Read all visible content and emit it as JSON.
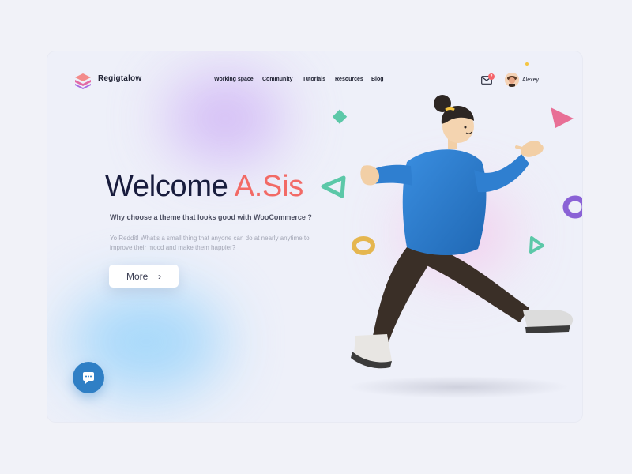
{
  "brand": {
    "name": "Regigtalow"
  },
  "nav": {
    "items": [
      {
        "label": "Working space"
      },
      {
        "label": "Community"
      },
      {
        "label": "Tutorials"
      },
      {
        "label": "Resources"
      },
      {
        "label": "Blog"
      }
    ]
  },
  "header": {
    "mail_badge": "2",
    "user_name": "Alexey"
  },
  "hero": {
    "welcome": "Welcome",
    "name": "A.Sis",
    "subtitle": "Why choose a theme that looks good with WooCommerce ?",
    "description": "Yo Reddit! What’s a small thing that anyone can do at nearly anytime to improve their mood and make them happier?",
    "more_label": "More"
  },
  "colors": {
    "accent": "#f26a66",
    "heading": "#181c3d",
    "chat_button": "#2f7fc5",
    "sweater": "#2f7fd0",
    "pants": "#3a2f27"
  },
  "icons": {
    "logo": "layers-logo-icon",
    "mail": "mail-icon",
    "chevron": "chevron-right-icon",
    "chat": "chat-bubble-icon"
  }
}
